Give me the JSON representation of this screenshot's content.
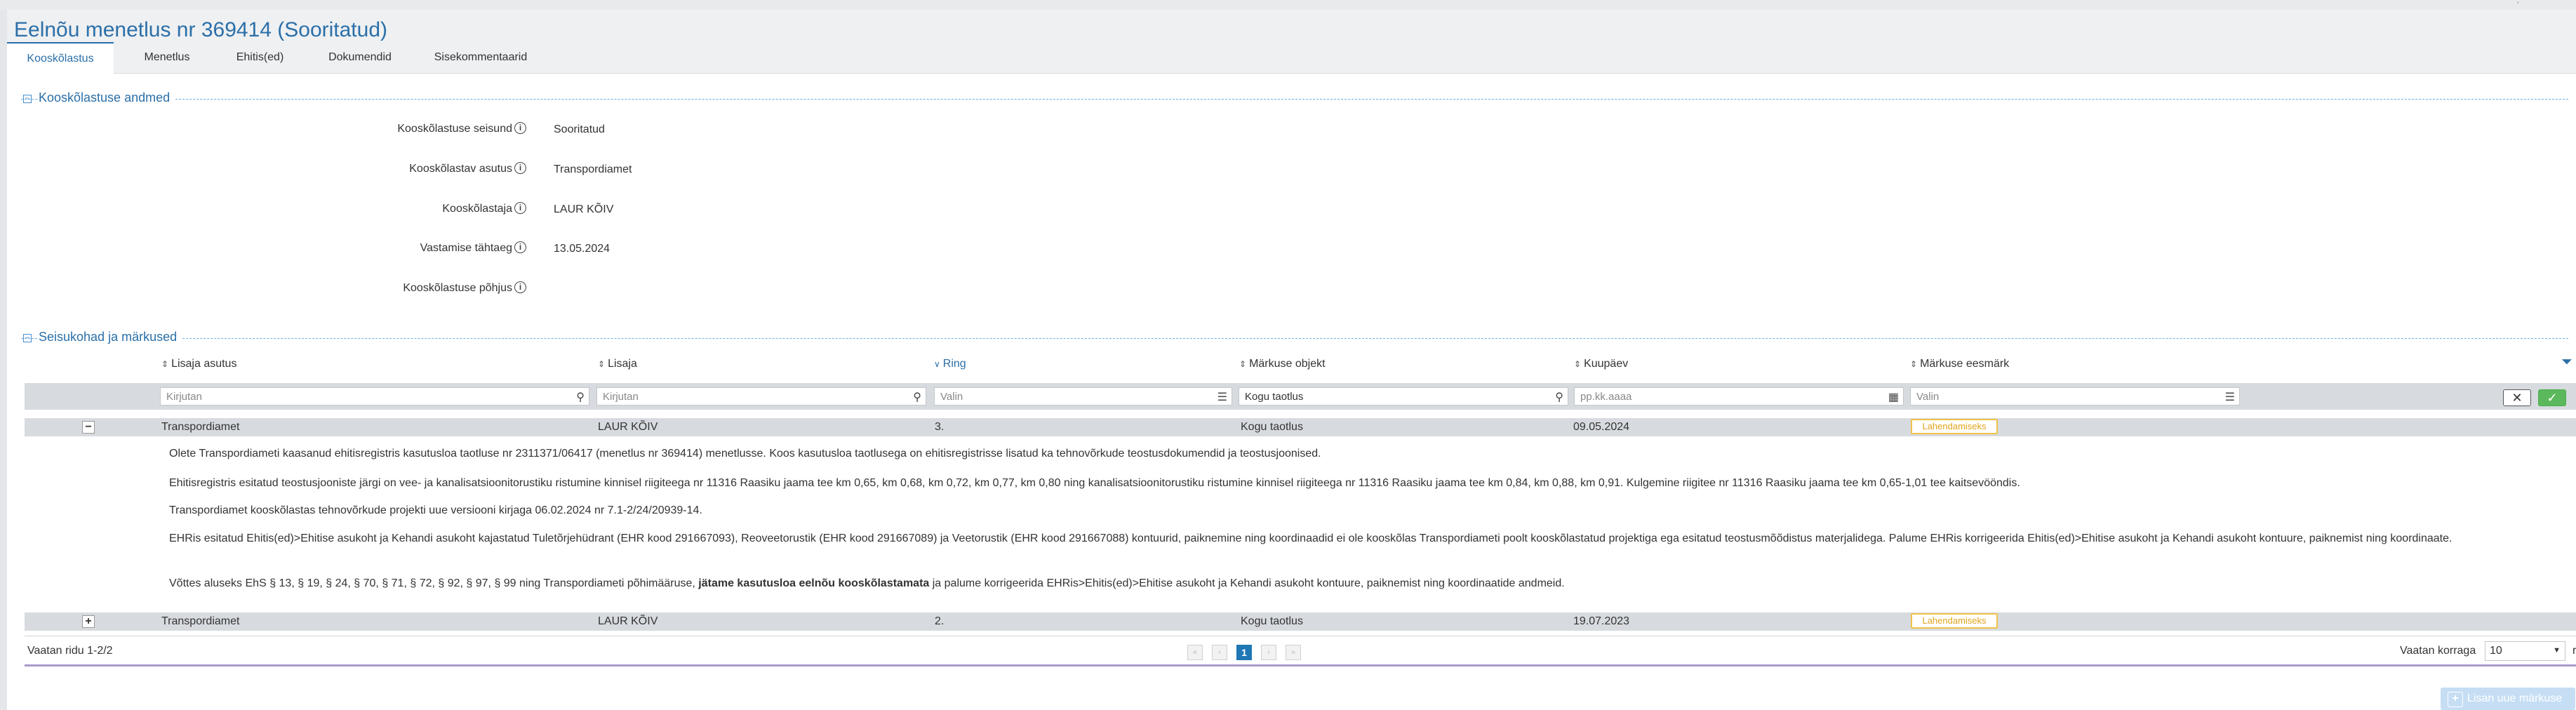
{
  "header": {
    "title": "Eelnõu menetlus nr 369414 (Sooritatud)"
  },
  "tabs": [
    {
      "label": "Kooskõlastus",
      "active": true
    },
    {
      "label": "Menetlus"
    },
    {
      "label": "Ehitis(ed)"
    },
    {
      "label": "Dokumendid"
    },
    {
      "label": "Sisekommentaarid"
    }
  ],
  "section1": {
    "title": "Kooskõlastuse andmed",
    "rows": [
      {
        "label": "Kooskõlastuse seisund",
        "value": "Sooritatud"
      },
      {
        "label": "Kooskõlastav asutus",
        "value": "Transpordiamet"
      },
      {
        "label": "Kooskõlastaja",
        "value": "LAUR KÕIV"
      },
      {
        "label": "Vastamise tähtaeg",
        "value": "13.05.2024"
      },
      {
        "label": "Kooskõlastuse põhjus",
        "value": ""
      }
    ],
    "info_glyph": "i"
  },
  "section2": {
    "title": "Seisukohad ja märkused",
    "columns": [
      "Lisaja asutus",
      "Lisaja",
      "Ring",
      "Märkuse objekt",
      "Kuupäev",
      "Märkuse eesmärk"
    ],
    "filters": [
      {
        "placeholder": "Kirjutan",
        "icon": "search-icon"
      },
      {
        "placeholder": "Kirjutan",
        "icon": "search-icon"
      },
      {
        "placeholder": "Valin",
        "icon": "list-icon"
      },
      {
        "value": "Kogu taotlus",
        "icon": "search-icon"
      },
      {
        "placeholder": "pp.kk.aaaa",
        "icon": "calendar-icon"
      },
      {
        "placeholder": "Valin",
        "icon": "list-icon"
      }
    ],
    "rows": [
      {
        "toggle": "−",
        "asutus": "Transpordiamet",
        "lisaja": "LAUR KÕIV",
        "ring": "3.",
        "objekt": "Kogu taotlus",
        "kuupaev": "09.05.2024",
        "eesmark": "Lahendamiseks"
      },
      {
        "toggle": "+",
        "asutus": "Transpordiamet",
        "lisaja": "LAUR KÕIV",
        "ring": "2.",
        "objekt": "Kogu taotlus",
        "kuupaev": "19.07.2023",
        "eesmark": "Lahendamiseks"
      }
    ],
    "detail": {
      "p1": "Olete Transpordiameti kaasanud ehitisregistris kasutusloa taotluse nr 2311371/06417 (menetlus nr 369414) menetlusse. Koos kasutusloa taotlusega on ehitisregistrisse lisatud ka tehnovõrkude teostusdokumendid ja teostusjoonised.",
      "p2": "Ehitisregistris esitatud teostusjooniste järgi on vee- ja kanalisatsioonitorustiku ristumine kinnisel riigiteega nr 11316 Raasiku jaama tee km 0,65, km 0,68, km 0,72, km 0,77, km 0,80 ning kanalisatsioonitorustiku ristumine kinnisel riigiteega nr 11316 Raasiku jaama tee km 0,84, km 0,88, km 0,91. Kulgemine riigitee nr 11316 Raasiku jaama tee km 0,65-1,01 tee kaitsevööndis.",
      "p3": "Transpordiamet kooskõlastas tehnovõrkude projekti uue versiooni kirjaga 06.02.2024 nr 7.1-2/24/20939-14.",
      "p4": "EHRis esitatud Ehitis(ed)>Ehitise asukoht ja Kehandi asukoht kajastatud Tuletõrjehüdrant (EHR kood 291667093), Reoveetorustik (EHR kood 291667089) ja Veetorustik (EHR kood 291667088) kontuurid, paiknemine ning koordinaadid ei ole kooskõlas Transpordiameti poolt kooskõlastatud projektiga ega esitatud teostusmõõdistus materjalidega. Palume EHRis korrigeerida Ehitis(ed)>Ehitise asukoht ja Kehandi asukoht kontuure, paiknemist ning koordinaate.",
      "p5_pre": "Võttes aluseks EhS § 13, § 19, § 24, § 70, § 71, § 72, § 92, § 97, § 99 ning Transpordiameti põhimääruse, ",
      "p5_bold": "jätame kasutusloa eelnõu kooskõlastamata",
      "p5_post": " ja palume korrigeerida EHRis>Ehitis(ed)>Ehitise asukoht ja Kehandi asukoht kontuure, paiknemist ning koordinaatide andmeid."
    },
    "pager": {
      "count_text": "Vaatan ridu 1-2/2",
      "current_page": "1",
      "nav": [
        "«",
        "‹",
        "›",
        "»"
      ],
      "size_label": "Vaatan korraga",
      "size_value": "10",
      "size_suffix": "rida"
    }
  },
  "add_button": "Lisan uue märkuse",
  "colors": {
    "accent": "#2b6fa8",
    "badge": "#f0c24a",
    "page_current": "#1f77b4"
  }
}
